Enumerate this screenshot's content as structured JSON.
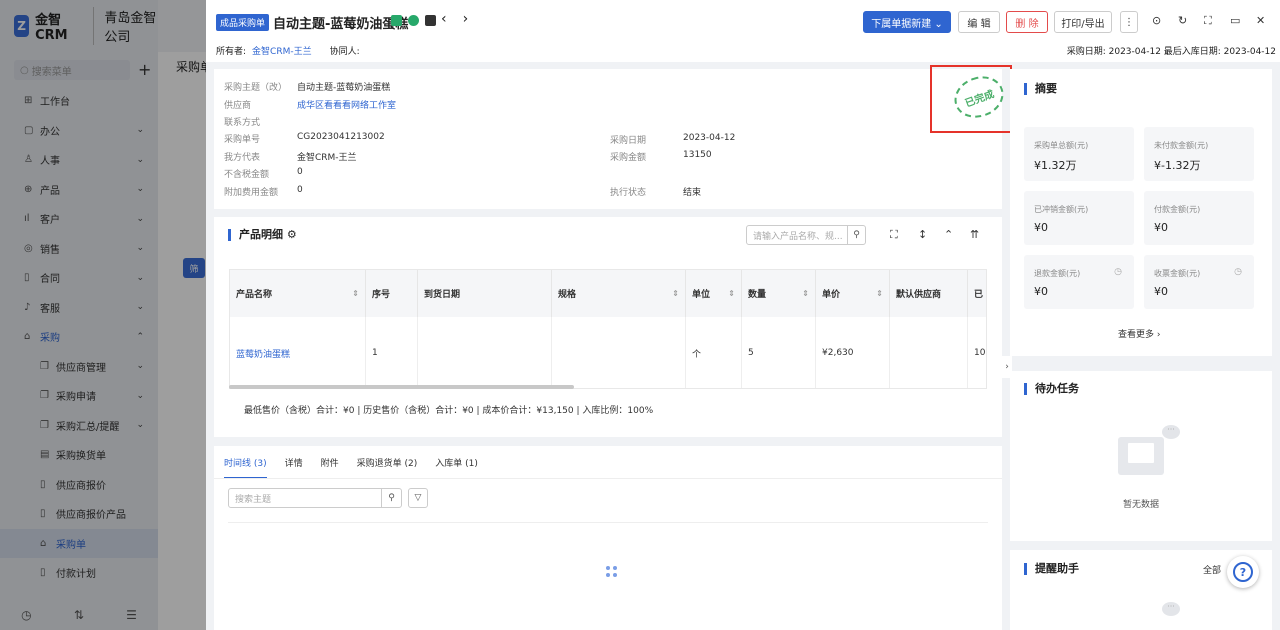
{
  "sidebar": {
    "brand": "金智CRM",
    "company": "青岛金智公司",
    "search_placeholder": "搜索菜单",
    "items": [
      {
        "label": "工作台",
        "icon": "⊞",
        "chevron": ""
      },
      {
        "label": "办公",
        "icon": "▢",
        "chevron": "⌄"
      },
      {
        "label": "人事",
        "icon": "♙",
        "chevron": "⌄"
      },
      {
        "label": "产品",
        "icon": "⊕",
        "chevron": "⌄"
      },
      {
        "label": "客户",
        "icon": "ıl",
        "chevron": "⌄"
      },
      {
        "label": "销售",
        "icon": "◎",
        "chevron": "⌄"
      },
      {
        "label": "合同",
        "icon": "▯",
        "chevron": "⌄"
      },
      {
        "label": "客服",
        "icon": "♪",
        "chevron": "⌄"
      },
      {
        "label": "采购",
        "icon": "⌂",
        "chevron": "⌃"
      },
      {
        "label": "供应商管理",
        "icon": "❐",
        "chevron": "⌄"
      },
      {
        "label": "采购申请",
        "icon": "❐",
        "chevron": "⌄"
      },
      {
        "label": "采购汇总/提醒",
        "icon": "❐",
        "chevron": "⌄"
      },
      {
        "label": "采购换货单",
        "icon": "▤",
        "chevron": ""
      },
      {
        "label": "供应商报价",
        "icon": "▯",
        "chevron": ""
      },
      {
        "label": "供应商报价产品",
        "icon": "▯",
        "chevron": ""
      },
      {
        "label": "采购单",
        "icon": "⌂",
        "chevron": ""
      },
      {
        "label": "付款计划",
        "icon": "▯",
        "chevron": ""
      }
    ],
    "footer_icons": [
      "history-icon",
      "sort-icon",
      "menu-collapse-icon"
    ]
  },
  "background_page": {
    "title": "采购单",
    "filter_btn": "筛"
  },
  "header": {
    "tag": "成品采购单",
    "title": "自动主题-蓝莓奶油蛋糕",
    "owner_label": "所有者:",
    "owner_value": "金智CRM-王兰",
    "collab_label": "协同人:",
    "dates": "采购日期: 2023-04-12   最后入库日期: 2023-04-12",
    "buttons": {
      "new_doc": "下属单据新建 ⌄",
      "edit": "编 辑",
      "delete": "删 除",
      "print": "打印/导出"
    }
  },
  "info": {
    "stamp": "已完成",
    "fields_left": [
      {
        "k": "采购主题（改）",
        "v": "自动主题-蓝莓奶油蛋糕",
        "link": false
      },
      {
        "k": "供应商",
        "v": "成华区看看看网络工作室",
        "link": true
      },
      {
        "k": "联系方式",
        "v": "",
        "link": false
      },
      {
        "k": "采购单号",
        "v": "CG2023041213002",
        "link": false
      },
      {
        "k": "我方代表",
        "v": "金智CRM-王兰",
        "link": false
      },
      {
        "k": "不含税金额",
        "v": "0",
        "link": false
      },
      {
        "k": "附加费用金额",
        "v": "0",
        "link": false
      }
    ],
    "fields_right": [
      {
        "k": "采购日期",
        "v": "2023-04-12"
      },
      {
        "k": "采购金额",
        "v": "13150"
      },
      {
        "k": "执行状态",
        "v": "结束"
      }
    ]
  },
  "products": {
    "title": "产品明细",
    "search_placeholder": "请输入产品名称、规...",
    "columns": [
      "产品名称",
      "序号",
      "到货日期",
      "规格",
      "单位",
      "数量",
      "单价",
      "默认供应商",
      "已"
    ],
    "rows": [
      [
        "蓝莓奶油蛋糕",
        "1",
        "",
        "",
        "个",
        "5",
        "¥2,630",
        "",
        "10"
      ]
    ],
    "summary": "最低售价（含税）合计：¥0 | 历史售价（含税）合计：¥0 | 成本价合计：¥13,150 | 入库比例：100%"
  },
  "timeline": {
    "tabs": [
      "时间线 (3)",
      "详情",
      "附件",
      "采购退货单 (2)",
      "入库单 (1)"
    ],
    "search_placeholder": "搜索主题"
  },
  "abstract": {
    "title": "摘要",
    "tiles": [
      {
        "k": "采购单总额(元)",
        "v": "¥1.32万"
      },
      {
        "k": "未付款金额(元)",
        "v": "¥-1.32万"
      },
      {
        "k": "已冲销金额(元)",
        "v": "¥0"
      },
      {
        "k": "付款金额(元)",
        "v": "¥0"
      },
      {
        "k": "退款金额(元)",
        "v": "¥0"
      },
      {
        "k": "收票金额(元)",
        "v": "¥0"
      }
    ],
    "more": "查看更多 ›"
  },
  "todo": {
    "title": "待办任务",
    "empty": "暂无数据"
  },
  "reminder": {
    "title": "提醒助手",
    "all": "全部"
  },
  "help": "?"
}
